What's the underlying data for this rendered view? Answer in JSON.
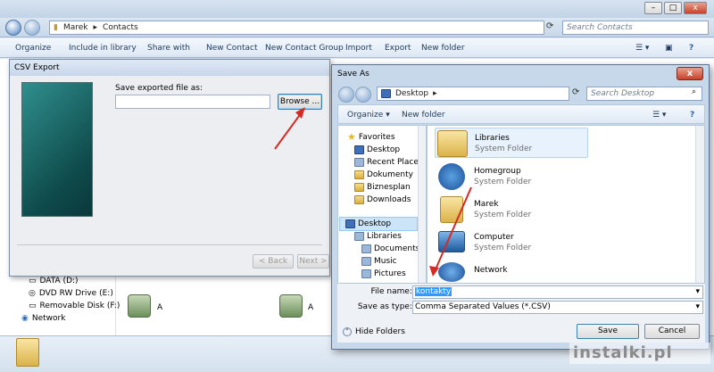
{
  "explorer": {
    "breadcrumb": [
      "Marek",
      "Contacts"
    ],
    "search_placeholder": "Search Contacts",
    "toolbar": [
      "Organize",
      "Include in library",
      "Share with",
      "New Contact",
      "New Contact Group",
      "Import",
      "Export",
      "New folder"
    ],
    "nav_items": [
      "DATA (D:)",
      "DVD RW Drive (E:)",
      "Removable Disk (F:)",
      "Network"
    ],
    "contact_letter_1": "A",
    "contact_letter_2": "A"
  },
  "csv_export": {
    "title": "CSV Export",
    "label": "Save exported file as:",
    "file_value": "",
    "browse_label": "Browse ...",
    "back_label": "< Back",
    "next_label": "Next >"
  },
  "save_as": {
    "title": "Save As",
    "close_label": "x",
    "location": "Desktop",
    "search_placeholder": "Search Desktop",
    "organize_label": "Organize",
    "new_folder_label": "New folder",
    "nav": [
      "Favorites",
      "Desktop",
      "Recent Places",
      "Dokumenty",
      "Biznesplan",
      "Downloads",
      "Desktop",
      "Libraries",
      "Documents",
      "Music",
      "Pictures"
    ],
    "items": [
      {
        "name": "Libraries",
        "sub": "System Folder"
      },
      {
        "name": "Homegroup",
        "sub": "System Folder"
      },
      {
        "name": "Marek",
        "sub": "System Folder"
      },
      {
        "name": "Computer",
        "sub": "System Folder"
      },
      {
        "name": "Network",
        "sub": ""
      }
    ],
    "file_name_label": "File name:",
    "file_name_value": "kontakty",
    "save_type_label": "Save as type:",
    "save_type_value": "Comma Separated Values (*.CSV)",
    "hide_folders_label": "Hide Folders",
    "save_label": "Save",
    "cancel_label": "Cancel"
  },
  "watermark": "instalki.pl",
  "colors": {
    "arrow": "#d42a23",
    "selection": "#3399ff"
  }
}
